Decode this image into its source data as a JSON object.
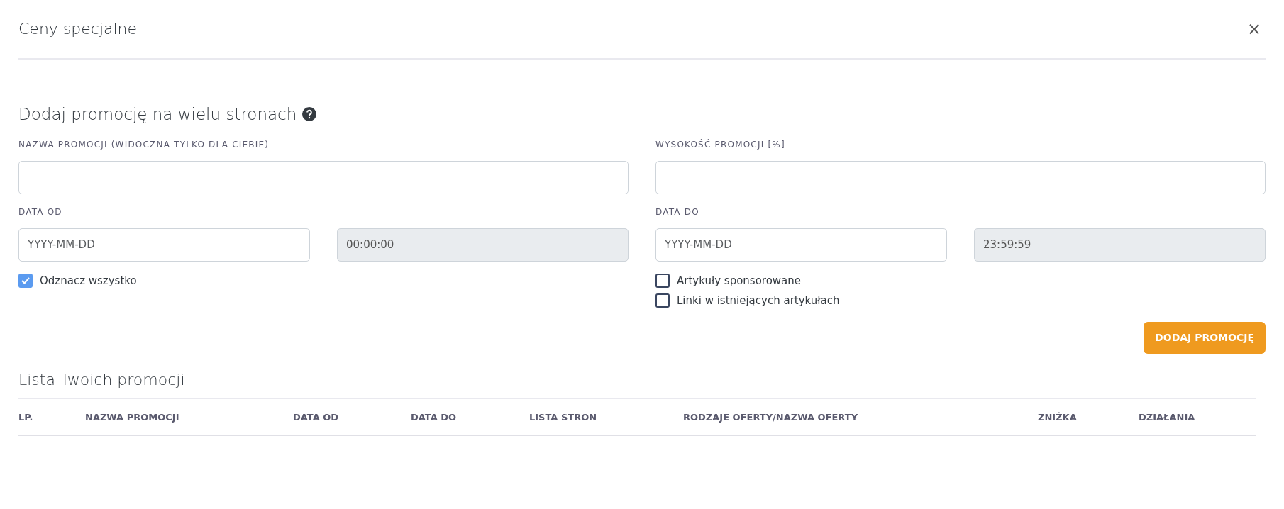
{
  "modal": {
    "title": "Ceny specjalne",
    "close": "×"
  },
  "form": {
    "heading": "Dodaj promocję na wielu stronach",
    "name_field": {
      "label": "NAZWA PROMOCJI (WIDOCZNA TYLKO DLA CIEBIE)"
    },
    "amount_field": {
      "label": "WYSOKOŚĆ PROMOCJI [%]"
    },
    "date_from": {
      "label": "DATA OD",
      "placeholder": "YYYY-MM-DD",
      "time": "00:00:00",
      "time_disabled": true
    },
    "date_to": {
      "label": "DATA DO",
      "placeholder": "YYYY-MM-DD",
      "time": "23:59:59",
      "time_disabled": true
    },
    "left_checkboxes": [
      {
        "label": "Odznacz wszystko",
        "checked": true
      }
    ],
    "right_checkboxes": [
      {
        "label": "Artykuły sponsorowane",
        "checked": false
      },
      {
        "label": "Linki w istniejących artykułach",
        "checked": false
      }
    ],
    "submit": "DODAJ PROMOCJĘ"
  },
  "table": {
    "title": "Lista Twoich promocji",
    "columns": [
      "LP.",
      "NAZWA PROMOCJI",
      "DATA OD",
      "DATA DO",
      "LISTA STRON",
      "RODZAJE OFERTY/NAZWA OFERTY",
      "ZNIŻKA",
      "DZIAŁANIA"
    ]
  }
}
